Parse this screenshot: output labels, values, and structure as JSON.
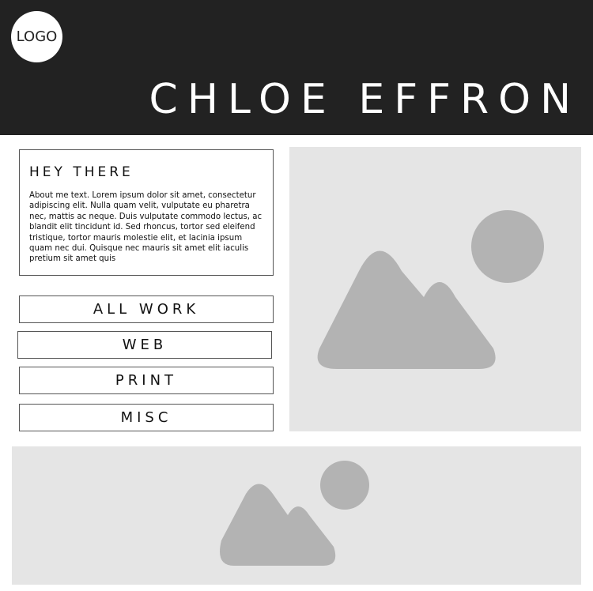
{
  "header": {
    "logo_text": "LOGO",
    "title": "CHLOE EFFRON",
    "background": "#222222"
  },
  "about": {
    "heading": "HEY THERE",
    "body": "About me text. Lorem ipsum dolor sit amet, consectetur adipiscing elit. Nulla quam velit, vulputate eu pharetra nec, mattis ac neque. Duis vulputate commodo lectus, ac blandit elit tincidunt id. Sed rhoncus, tortor sed eleifend tristique, tortor mauris molestie elit, et lacinia ipsum quam nec dui. Quisque nec mauris sit amet elit iaculis pretium sit amet quis"
  },
  "nav": {
    "items": [
      {
        "label": "ALL WORK"
      },
      {
        "label": "WEB"
      },
      {
        "label": "PRINT"
      },
      {
        "label": "MISC"
      }
    ]
  },
  "images": {
    "hero": {
      "icon": "image-placeholder-icon"
    },
    "banner": {
      "icon": "image-placeholder-icon"
    },
    "placeholder_bg": "#e5e5e5",
    "placeholder_fg": "#b3b3b3"
  }
}
